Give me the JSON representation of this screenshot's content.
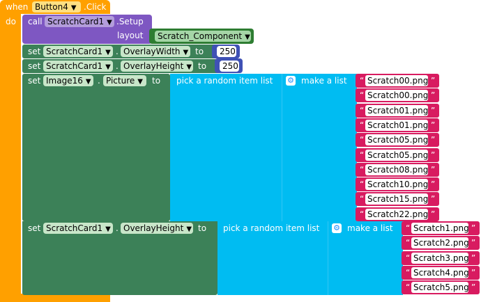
{
  "event": {
    "when": "when",
    "component": "Button4",
    "event": ".Click",
    "do": "do"
  },
  "call": {
    "label": "call",
    "component": "ScratchCard1",
    "method": ".Setup",
    "layout_label": "layout",
    "layout_value": "Scratch_Component"
  },
  "set_width": {
    "set": "set",
    "component": "ScratchCard1",
    "dot": ".",
    "property": "OverlayWidth",
    "to": "to",
    "value": "250"
  },
  "set_height": {
    "set": "set",
    "component": "ScratchCard1",
    "dot": ".",
    "property": "OverlayHeight",
    "to": "to",
    "value": "250"
  },
  "set_picture": {
    "set": "set",
    "component": "Image16",
    "dot": ".",
    "property": "Picture",
    "to": "to",
    "pick": "pick a random item  list",
    "make": "make a list",
    "items": [
      "Scratch00.png",
      "Scratch00.png",
      "Scratch01.png",
      "Scratch01.png",
      "Scratch05.png",
      "Scratch05.png",
      "Scratch08.png",
      "Scratch10.png",
      "Scratch15.png",
      "Scratch22.png"
    ]
  },
  "set_height2": {
    "set": "set",
    "component": "ScratchCard1",
    "dot": ".",
    "property": "OverlayHeight",
    "to": "to",
    "pick": "pick a random item  list",
    "make": "make a list",
    "items": [
      "Scratch1.png",
      "Scratch2.png",
      "Scratch3.png",
      "Scratch4.png",
      "Scratch5.png"
    ]
  },
  "colors": {
    "event": "#ffa000",
    "call": "#7e57c2",
    "component": "#2e7d32",
    "setter": "#3c8158",
    "list": "#00bcf2",
    "math": "#3f51b5",
    "text": "#d81b60",
    "dropdown_event": "#ffe082"
  }
}
